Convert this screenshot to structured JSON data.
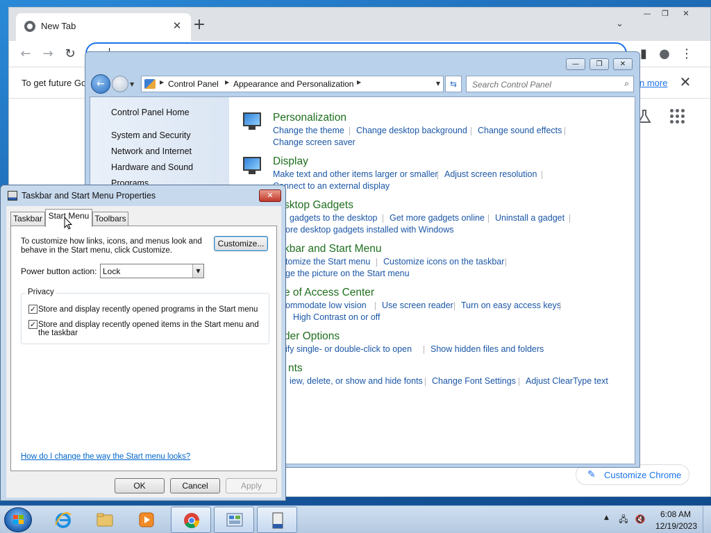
{
  "chrome": {
    "tab_title": "New Tab",
    "tab_close": "✕",
    "new_tab": "+",
    "infobar_text": "To get future Go",
    "infobar_link": "n more",
    "infobar_close": "✕",
    "customize_label": "Customize Chrome",
    "window_controls": [
      "—",
      "❐",
      "✕"
    ]
  },
  "control_panel": {
    "breadcrumbs": [
      "Control Panel",
      "Appearance and Personalization"
    ],
    "search_placeholder": "Search Control Panel",
    "sidebar": [
      "Control Panel Home",
      "System and Security",
      "Network and Internet",
      "Hardware and Sound",
      "Programs"
    ],
    "categories": [
      {
        "title": "Personalization",
        "links": [
          "Change the theme",
          "Change desktop background",
          "Change sound effects",
          "Change screen saver"
        ]
      },
      {
        "title": "Display",
        "links": [
          "Make text and other items larger or smaller",
          "Adjust screen resolution",
          "Connect to an external display"
        ]
      },
      {
        "title": "sktop Gadgets",
        "links": [
          "gadgets to the desktop",
          "Get more gadgets online",
          "Uninstall a gadget",
          "ore desktop gadgets installed with Windows"
        ]
      },
      {
        "title": "kbar and Start Menu",
        "links": [
          "tomize the Start menu",
          "Customize icons on the taskbar",
          "ge the picture on the Start menu"
        ]
      },
      {
        "title": "e of Access Center",
        "links": [
          "ommodate low vision",
          "Use screen reader",
          "Turn on easy access keys",
          "High Contrast on or off"
        ]
      },
      {
        "title": "der Options",
        "links": [
          "ify single- or double-click to open",
          "Show hidden files and folders"
        ]
      },
      {
        "title": "nts",
        "links": [
          "iew, delete, or show and hide fonts",
          "Change Font Settings",
          "Adjust ClearType text"
        ]
      }
    ]
  },
  "dialog": {
    "title": "Taskbar and Start Menu Properties",
    "close": "✕",
    "tabs": [
      "Taskbar",
      "Start Menu",
      "Toolbars"
    ],
    "description": "To customize how links, icons, and menus look and behave in the Start menu, click Customize.",
    "customize_button": "Customize...",
    "power_label": "Power button action:",
    "power_value": "Lock",
    "privacy_label": "Privacy",
    "check1": "Store and display recently opened programs in the Start menu",
    "check2": "Store and display recently opened items in the Start menu and the taskbar",
    "check_mark": "✓",
    "help_link": "How do I change the way the Start menu looks?",
    "ok": "OK",
    "cancel": "Cancel",
    "apply": "Apply"
  },
  "taskbar": {
    "time": "6:08 AM",
    "date": "12/19/2023"
  },
  "colors": {
    "link_blue": "#1a56a6",
    "category_green": "#1e6e1e",
    "chrome_blue": "#1a73e8"
  }
}
